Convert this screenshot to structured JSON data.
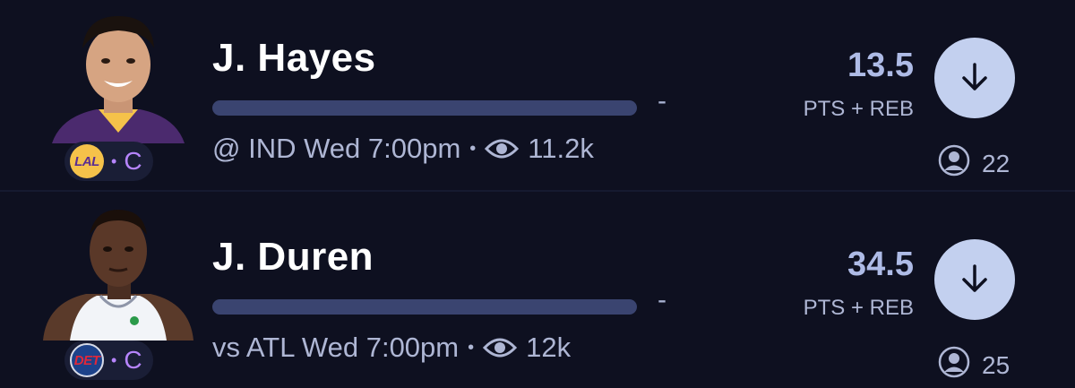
{
  "players": [
    {
      "name": "J. Hayes",
      "team": "LAL",
      "position": "C",
      "progress_value": "-",
      "progress_fraction": 0,
      "game": "@ IND Wed 7:00pm",
      "views": "11.2k",
      "line": "13.5",
      "stat": "PTS + REB",
      "picks": "22",
      "direction_icon": "arrow-down-icon"
    },
    {
      "name": "J. Duren",
      "team": "DET",
      "position": "C",
      "progress_value": "-",
      "progress_fraction": 0,
      "game": "vs ATL Wed 7:00pm",
      "views": "12k",
      "line": "34.5",
      "stat": "PTS + REB",
      "picks": "25",
      "direction_icon": "arrow-down-icon"
    }
  ],
  "colors": {
    "background": "#0e1020",
    "accent": "#c3d0ef",
    "position_text": "#b785ff",
    "lal_gold": "#f5c24a",
    "lal_purple": "#5a2d91",
    "det_blue": "#1d428a",
    "det_red": "#e0283a"
  }
}
